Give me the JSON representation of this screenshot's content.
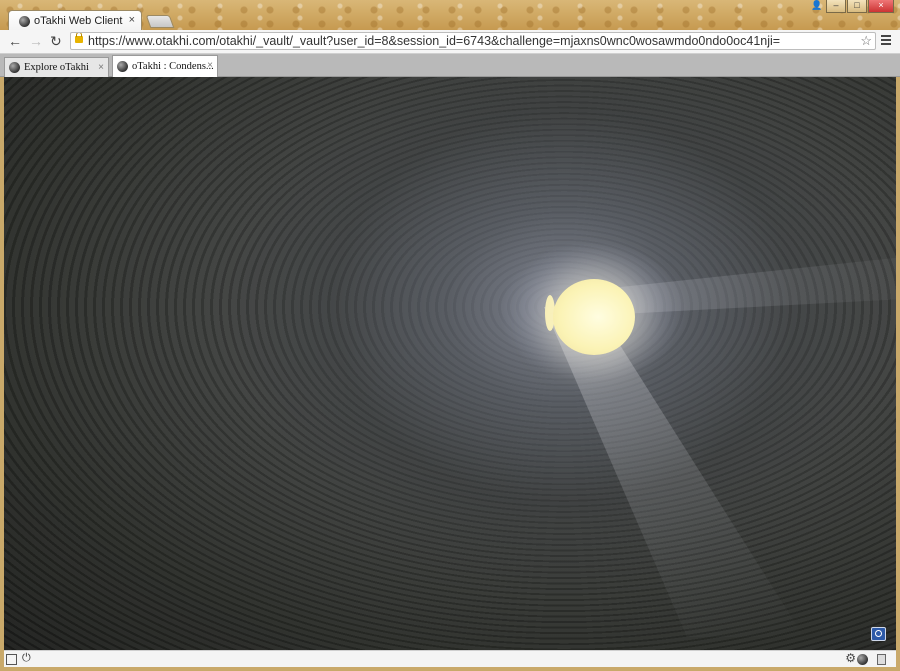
{
  "browser": {
    "tab_title": "oTakhi Web Client",
    "tab_close": "×",
    "url": "https://www.otakhi.com/otakhi/_vault/_vault?user_id=8&session_id=6743&challenge=mjaxns0wnc0wosawmdo0ndo0oc41nji=",
    "star": "☆",
    "back": "←",
    "forward": "→",
    "reload": "↻"
  },
  "window_controls": {
    "user": "👤",
    "minimize": "–",
    "maximize": "□",
    "close": "×"
  },
  "app_tabs": [
    {
      "label": "Explore oTakhi",
      "close": "×"
    },
    {
      "label": "oTakhi : Condens...",
      "close": "×"
    }
  ],
  "statusbar": {
    "power": "⏻",
    "gear": "⚙"
  },
  "colors": {
    "theme_gold": "#c9a96a",
    "light_yellow": "#fbf3b5",
    "camera_button": "#2d5aa8"
  },
  "icons": {
    "favicon": "otakhi-globe-icon",
    "security": "lock-icon",
    "bookmark": "star-icon",
    "menu": "hamburger-menu-icon",
    "camera": "camera-view-icon",
    "panel": "panel-toggle-icon",
    "power": "power-icon",
    "settings": "gear-icon",
    "document": "document-icon"
  }
}
